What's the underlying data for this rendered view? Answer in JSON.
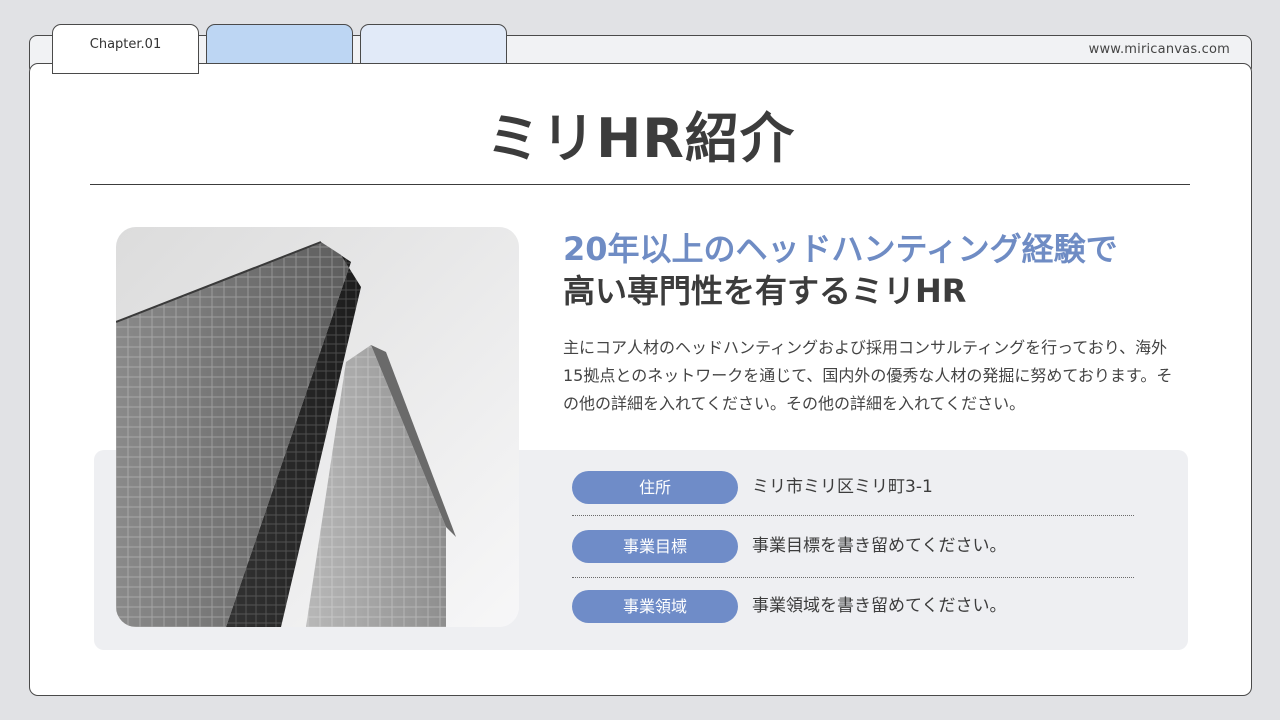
{
  "header": {
    "url": "www.miricanvas.com",
    "tabs": [
      {
        "label": "Chapter.01"
      },
      {
        "label": ""
      },
      {
        "label": ""
      }
    ]
  },
  "slide": {
    "title": "ミリHR紹介",
    "headline_line1": "20年以上のヘッドハンティング経験で",
    "headline_line2": "高い専門性を有するミリHR",
    "body": "主にコア人材のヘッドハンティングおよび採用コンサルティングを行っており、海外15拠点とのネットワークを通じて、国内外の優秀な人材の発掘に努めております。その他の詳細を入れてください。その他の詳細を入れてください。",
    "info_rows": [
      {
        "label": "住所",
        "value": "ミリ市ミリ区ミリ町3-1"
      },
      {
        "label": "事業目標",
        "value": "事業目標を書き留めてください。"
      },
      {
        "label": "事業領域",
        "value": "事業領域を書き留めてください。"
      }
    ]
  },
  "colors": {
    "accent_blue": "#6f8cc4",
    "pill_blue": "#6f8cc8",
    "tab_blue": "#bdd6f3",
    "tab_light_blue": "#e1eaf8",
    "text_dark": "#3c3c3c"
  },
  "image": {
    "subject": "building-photo"
  }
}
